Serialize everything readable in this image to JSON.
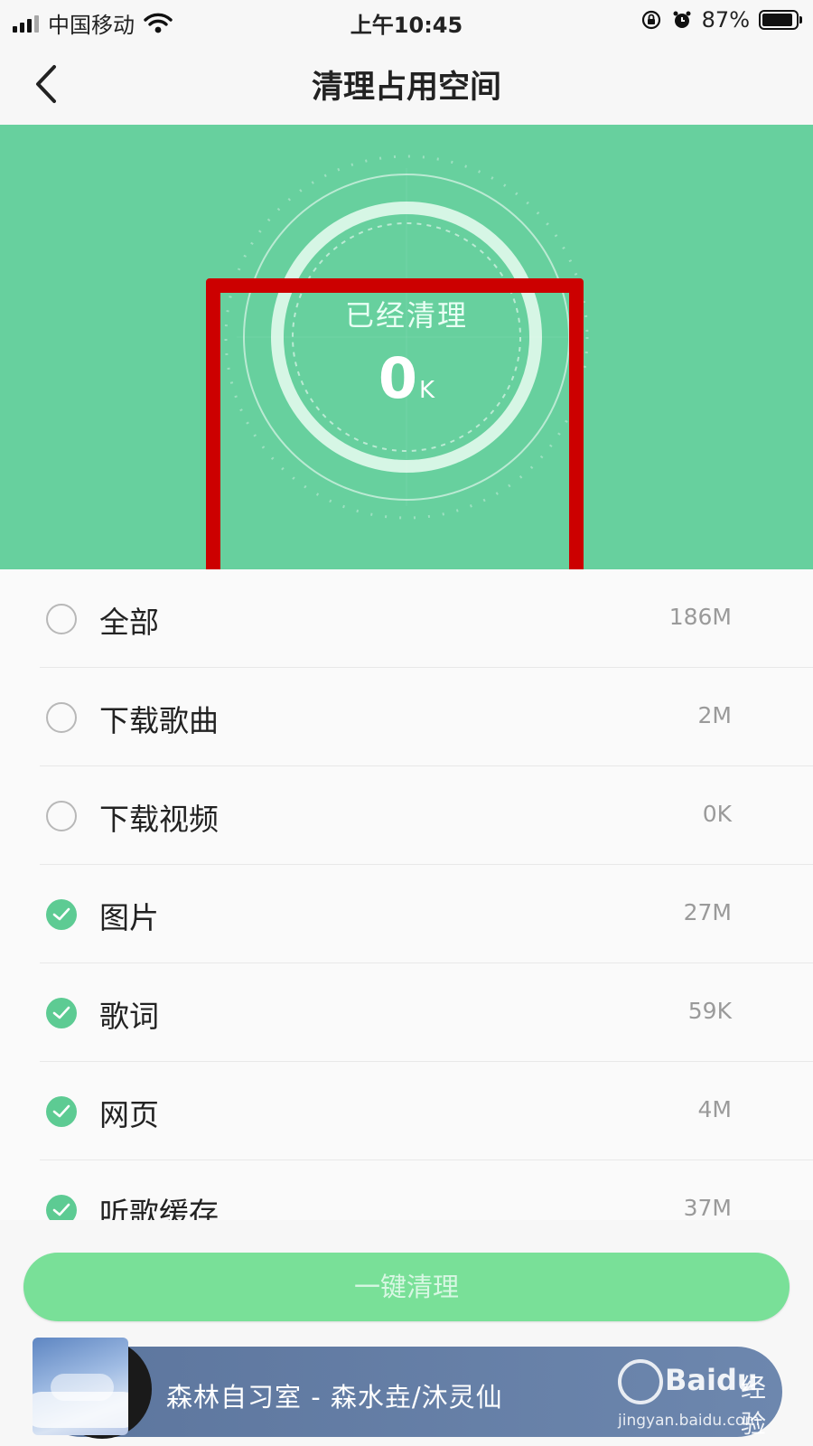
{
  "status_bar": {
    "carrier": "中国移动",
    "time": "上午10:45",
    "battery": "87%",
    "battery_level": 0.87,
    "icons": [
      "signal-icon",
      "wifi-icon",
      "rotation-lock-icon",
      "alarm-icon",
      "battery-icon"
    ]
  },
  "nav": {
    "back_icon": "chevron-left-icon",
    "title": "清理占用空间"
  },
  "summary": {
    "label": "已经清理",
    "value": "0",
    "unit": "K"
  },
  "items": [
    {
      "label": "全部",
      "size": "186M",
      "checked": false
    },
    {
      "label": "下载歌曲",
      "size": "2M",
      "checked": false
    },
    {
      "label": "下载视频",
      "size": "0K",
      "checked": false
    },
    {
      "label": "图片",
      "size": "27M",
      "checked": true
    },
    {
      "label": "歌词",
      "size": "59K",
      "checked": true
    },
    {
      "label": "网页",
      "size": "4M",
      "checked": true
    },
    {
      "label": "听歌缓存",
      "size": "37M",
      "checked": true
    }
  ],
  "clean_button": {
    "label": "一键清理"
  },
  "player": {
    "track": "森林自习室 - 森水垚/沐灵仙"
  },
  "watermark": {
    "brand": "Baidu",
    "text": "经验",
    "url": "jingyan.baidu.com"
  },
  "colors": {
    "accent": "#67d09e",
    "check": "#5dcb93",
    "button": "#79e098",
    "highlight": "#cc0000",
    "player": "#5c759d"
  }
}
